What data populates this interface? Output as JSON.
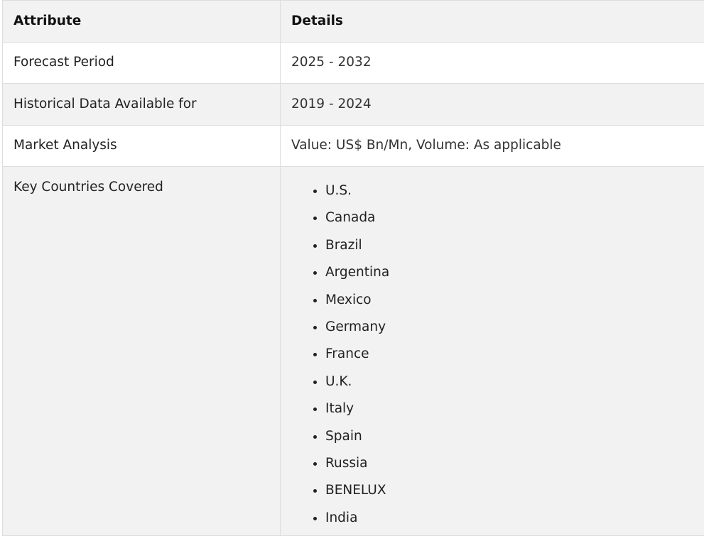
{
  "table": {
    "headers": {
      "attribute": "Attribute",
      "details": "Details"
    },
    "rows": [
      {
        "attribute": "Forecast Period",
        "details": "2025 - 2032"
      },
      {
        "attribute": "Historical Data Available for",
        "details": "2019 - 2024"
      },
      {
        "attribute": "Market Analysis",
        "details": "Value: US$ Bn/Mn, Volume: As applicable"
      }
    ],
    "countries_row": {
      "attribute": "Key Countries Covered",
      "items": [
        "U.S.",
        "Canada",
        "Brazil",
        "Argentina",
        "Mexico",
        "Germany",
        "France",
        "U.K.",
        "Italy",
        "Spain",
        "Russia",
        "BENELUX",
        "India"
      ]
    }
  }
}
